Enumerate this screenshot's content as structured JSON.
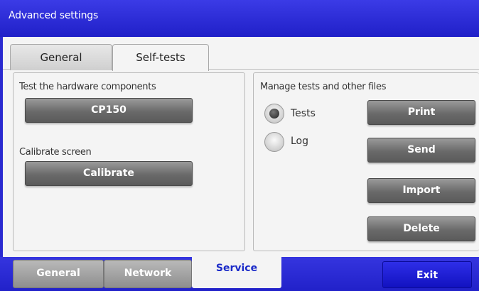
{
  "window": {
    "title": "Advanced settings"
  },
  "top_tabs": [
    {
      "label": "General",
      "active": false
    },
    {
      "label": "Self-tests",
      "active": true
    }
  ],
  "left_panel": {
    "hardware_label": "Test the hardware components",
    "hardware_button": "CP150",
    "calibrate_label": "Calibrate screen",
    "calibrate_button": "Calibrate"
  },
  "right_panel": {
    "manage_label": "Manage tests and other files",
    "radios": [
      {
        "label": "Tests",
        "selected": true
      },
      {
        "label": "Log",
        "selected": false
      }
    ],
    "buttons": {
      "print": "Print",
      "send": "Send",
      "import": "Import",
      "delete": "Delete"
    }
  },
  "bottom_nav": {
    "tabs": [
      {
        "label": "General",
        "active": false
      },
      {
        "label": "Network",
        "active": false
      },
      {
        "label": "Service",
        "active": true
      }
    ],
    "exit": "Exit"
  },
  "colors": {
    "accent_blue": "#2a2ad0",
    "button_gray": "#6a6a6a",
    "active_tab_text": "#1a2ac8"
  }
}
